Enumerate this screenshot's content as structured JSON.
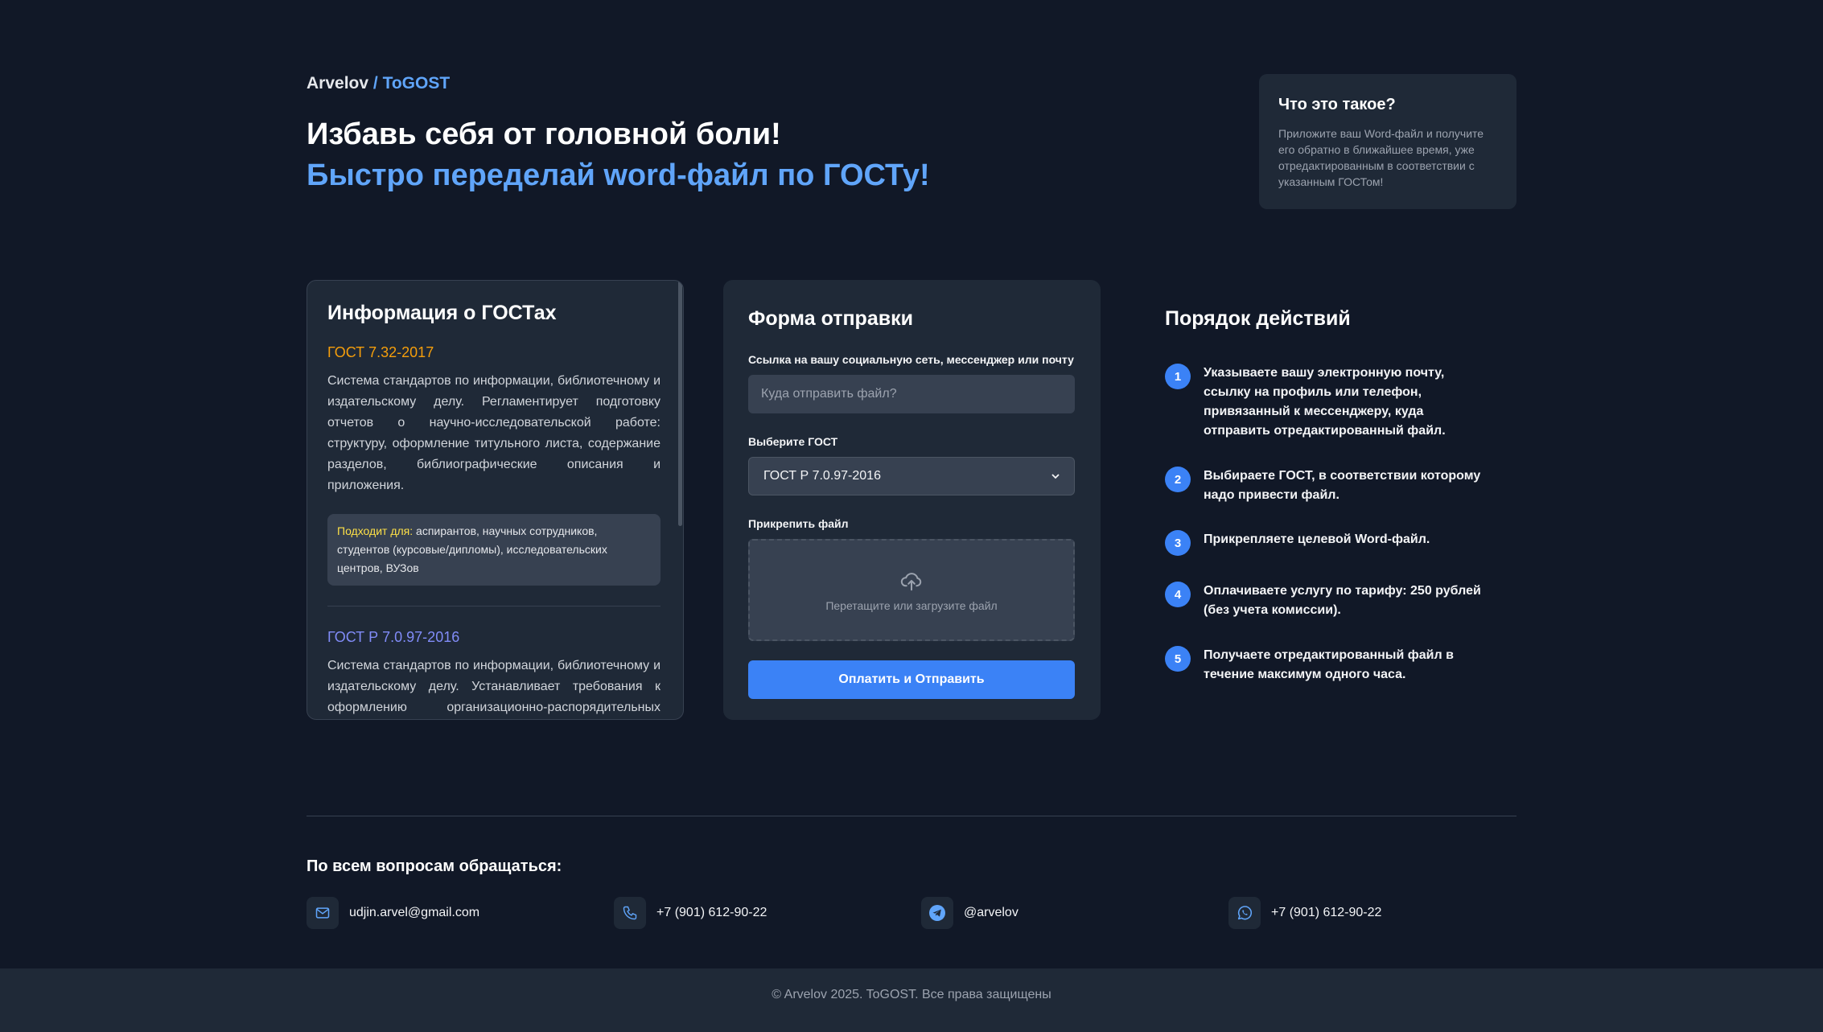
{
  "brand": {
    "owner": "Arvelov",
    "separator": "/",
    "product": "ToGOST"
  },
  "hero": {
    "line1": "Избавь себя от головной боли!",
    "line2": "Быстро переделай word-файл по ГОСТу!"
  },
  "about": {
    "title": "Что это такое?",
    "text": "Приложите ваш Word-файл и получите его обратно в ближайшее время, уже отредактированным в соответствии с указанным ГОСТом!"
  },
  "info": {
    "title": "Информация о ГОСТах",
    "items": [
      {
        "name": "ГОСТ 7.32-2017",
        "description": "Система стандартов по информации, библиотечному и издательскому делу. Регламентирует подготовку отчетов о научно-исследовательской работе: структуру, оформление титульного листа, содержание разделов, библиографические описания и приложения.",
        "fits_label": "Подходит для:",
        "fits_text": "аспирантов, научных сотрудников, студентов (курсовые/дипломы), исследовательских центров, ВУЗов"
      },
      {
        "name": "ГОСТ Р 7.0.97-2016",
        "description": "Система стандартов по информации, библиотечному и издательскому делу. Устанавливает требования к оформлению организационно-распорядительных документов: бланки, реквизиты, правила составления и оформления служебной документации."
      }
    ]
  },
  "form": {
    "title": "Форма отправки",
    "contact_label": "Ссылка на вашу социальную сеть, мессенджер или почту",
    "contact_placeholder": "Куда отправить файл?",
    "gost_label": "Выберите ГОСТ",
    "gost_selected": "ГОСТ Р 7.0.97-2016",
    "file_label": "Прикрепить файл",
    "dropzone_text": "Перетащите или загрузите файл",
    "submit_label": "Оплатить и Отправить"
  },
  "steps": {
    "title": "Порядок действий",
    "items": [
      {
        "num": "1",
        "text": "Указываете вашу электронную почту, ссылку на профиль или телефон, привязанный к мессенджеру, куда отправить отредактированный файл."
      },
      {
        "num": "2",
        "text": "Выбираете ГОСТ, в соответствии которому надо привести файл."
      },
      {
        "num": "3",
        "text": "Прикрепляете целевой Word-файл."
      },
      {
        "num": "4",
        "text": "Оплачиваете услугу по тарифу: 250 рублей (без учета комиссии)."
      },
      {
        "num": "5",
        "text": "Получаете отредактированный файл в течение максимум одного часа."
      }
    ]
  },
  "contacts": {
    "title": "По всем вопросам обращаться:",
    "items": [
      {
        "icon": "mail-icon",
        "value": "udjin.arvel@gmail.com"
      },
      {
        "icon": "phone-icon",
        "value": "+7 (901) 612-90-22"
      },
      {
        "icon": "telegram-icon",
        "value": "@arvelov"
      },
      {
        "icon": "whatsapp-icon",
        "value": "+7 (901) 612-90-22"
      }
    ]
  },
  "footer": {
    "copyright": "© Arvelov 2025. ToGOST. Все права защищены"
  },
  "colors": {
    "background": "#111827",
    "card": "#1f2937",
    "accent": "#3b82f6",
    "accent_text": "#60a5fa",
    "gost_a": "#f59e0b",
    "gost_b": "#818cf8"
  }
}
